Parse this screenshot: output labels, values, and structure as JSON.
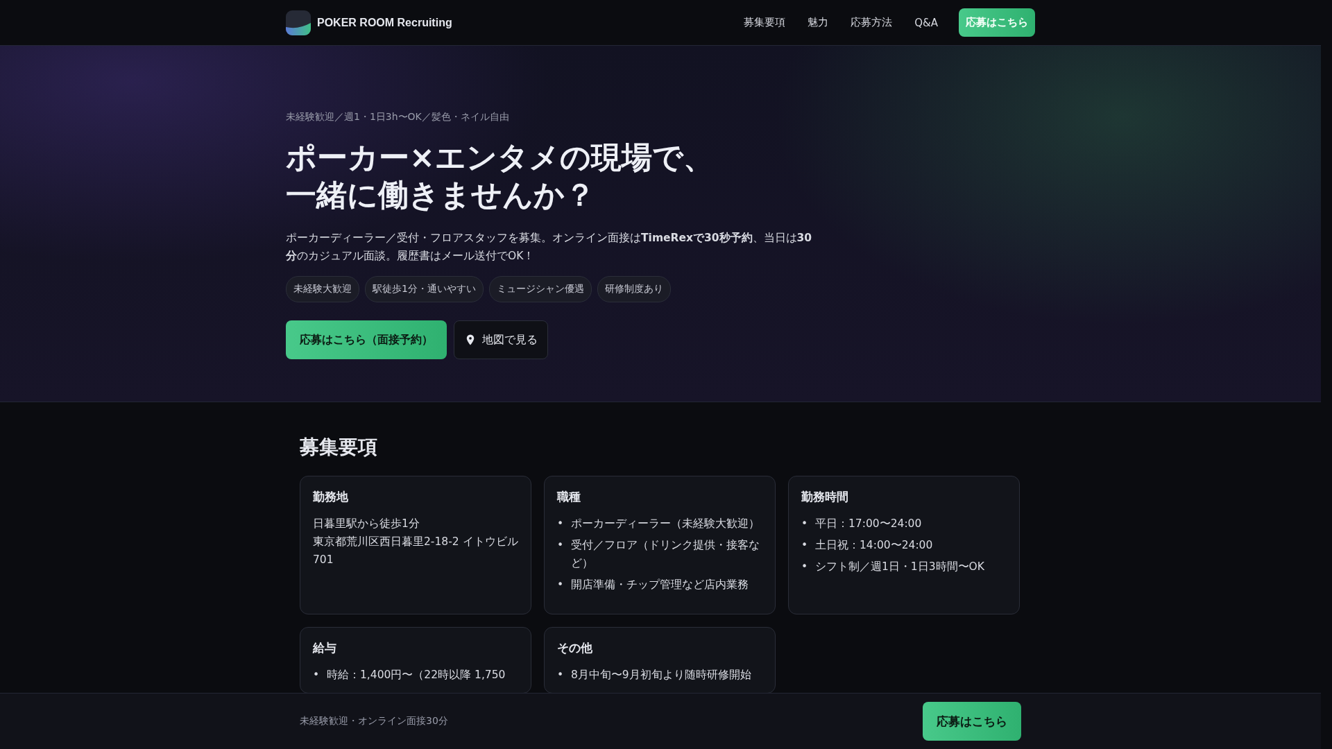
{
  "header": {
    "logo_text": "POKER ROOM Recruiting",
    "nav": [
      "募集要項",
      "魅力",
      "応募方法",
      "Q&A"
    ],
    "cta": "応募はこちら"
  },
  "hero": {
    "tagline": "未経験歓迎／週1・1日3h〜OK／髪色・ネイル自由",
    "title_lines": [
      "ポーカー×エンタメの現場で、",
      "一緒に働きませんか？"
    ],
    "description": "ポーカーディーラー／受付・フロアスタッフを募集。オンライン面接は**TimeRexで30秒予約**、当日は**30分**のカジュアル面談。履歴書はメール送付でOK！",
    "chips": [
      "未経験大歓迎",
      "駅徒歩1分・通いやすい",
      "ミュージシャン優遇",
      "研修制度あり"
    ],
    "primary_button": "応募はこちら（面接予約）",
    "map_button": "地図で見る"
  },
  "section": {
    "title": "募集要項",
    "bullet": "•",
    "cards": [
      {
        "title": "勤務地",
        "kind": "text",
        "lines": [
          "日暮里駅から徒歩1分",
          "東京都荒川区西日暮里2-18-2 イトウビル701"
        ]
      },
      {
        "title": "職種",
        "kind": "list",
        "lines": [
          "ポーカーディーラー（未経験大歓迎）",
          "受付／フロア（ドリンク提供・接客など）",
          "開店準備・チップ管理など店内業務"
        ]
      },
      {
        "title": "勤務時間",
        "kind": "list",
        "lines": [
          "平日：17:00〜24:00",
          "土日祝：14:00〜24:00",
          "シフト制／週1日・1日3時間〜OK"
        ]
      },
      {
        "title": "給与",
        "kind": "list",
        "lines": [
          "時給：1,400円〜（22時以降 1,750"
        ]
      },
      {
        "title": "その他",
        "kind": "list",
        "lines": [
          "8月中旬〜9月初旬より随時研修開始"
        ]
      }
    ]
  },
  "bottom_bar": {
    "text": "未経験歓迎・オンライン面接30分",
    "button": "応募はこちら"
  }
}
